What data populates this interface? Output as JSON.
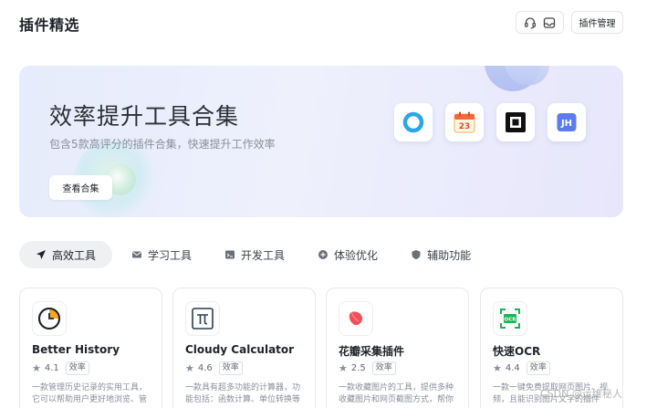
{
  "header": {
    "title": "插件精选",
    "manage_label": "插件管理",
    "icons": [
      "headset-icon",
      "inbox-icon"
    ]
  },
  "banner": {
    "title": "效率提升工具合集",
    "subtitle": "包含5款高评分的插件合集，快速提升工作效率",
    "button_label": "查看合集",
    "tiles": [
      "ring-icon",
      "calendar-icon",
      "frame-icon",
      "jh-icon"
    ],
    "calendar_day": "23",
    "jh_text": "JH"
  },
  "tabs": [
    {
      "label": "高效工具",
      "icon": "send-icon",
      "active": true
    },
    {
      "label": "学习工具",
      "icon": "mail-icon",
      "active": false
    },
    {
      "label": "开发工具",
      "icon": "code-icon",
      "active": false
    },
    {
      "label": "体验优化",
      "icon": "plus-circle-icon",
      "active": false
    },
    {
      "label": "辅助功能",
      "icon": "shield-icon",
      "active": false
    }
  ],
  "cards": [
    {
      "name": "Better History",
      "rating": "4.1",
      "badge": "效率",
      "desc": "一款管理历史记录的实用工具，它可以帮助用户更好地浏览、管理…",
      "icon": "clock-icon"
    },
    {
      "name": "Cloudy Calculator",
      "rating": "4.6",
      "badge": "效率",
      "desc": "一款具有超多功能的计算器，功能包括：函数计算、单位转换等",
      "icon": "pi-icon"
    },
    {
      "name": "花瓣采集插件",
      "rating": "2.5",
      "badge": "效率",
      "desc": "一款收藏图片的工具，提供多种收藏图片和网页截图方式，帮你高…",
      "icon": "petal-icon"
    },
    {
      "name": "快速OCR",
      "rating": "4.4",
      "badge": "效率",
      "desc": "一款一键免费提取网页图片、视频，且能识别图片文字的插件",
      "icon": "ocr-icon"
    }
  ],
  "watermark": "CSDN @运维秘人",
  "colors": {
    "accent": "#4f6ef7",
    "ocr_green": "#19b455",
    "ring_blue": "#2aa6e8",
    "petal_red": "#f0505a"
  }
}
